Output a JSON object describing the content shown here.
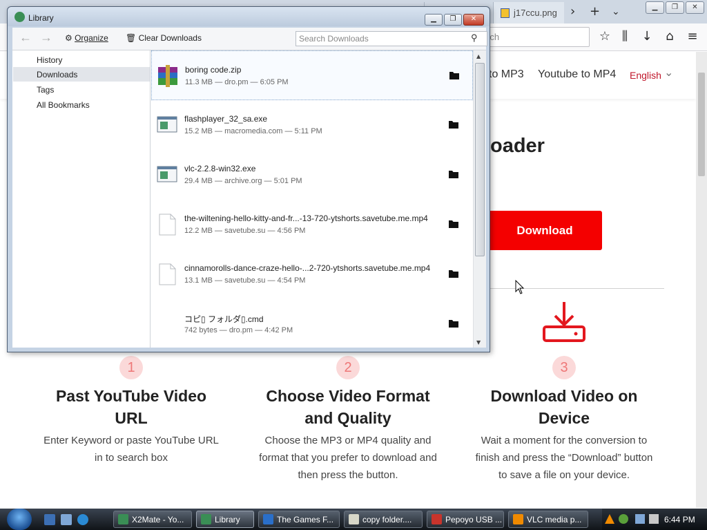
{
  "browser": {
    "tabs": {
      "image_tab_label": "j17ccu.png"
    },
    "urlbar": {
      "placeholder": "rch"
    }
  },
  "website": {
    "nav": {
      "links": [
        "to MP3",
        "Youtube to MP4"
      ],
      "language": "English"
    },
    "hero_title": "oader",
    "download_button": "Download",
    "steps": [
      {
        "num": "1",
        "title": "Past YouTube Video URL",
        "desc": "Enter Keyword or paste YouTube URL in to search box"
      },
      {
        "num": "2",
        "title": "Choose Video Format and Quality",
        "desc": "Choose the MP3 or MP4 quality and format that you prefer to download and then press the button."
      },
      {
        "num": "3",
        "title": "Download Video on Device",
        "desc": "Wait a moment for the conversion to finish and press the “Download” button to save a file on your device."
      }
    ],
    "accent_color": "#f40000"
  },
  "library": {
    "title": "Library",
    "toolbar": {
      "organize": "Organize",
      "clear_downloads": "Clear Downloads",
      "search_placeholder": "Search Downloads"
    },
    "sidebar": [
      "History",
      "Downloads",
      "Tags",
      "All Bookmarks"
    ],
    "downloads": [
      {
        "name": "boring code.zip",
        "meta": "11.3 MB — dro.pm — 6:05 PM",
        "icon": "archive-icon"
      },
      {
        "name": "flashplayer_32_sa.exe",
        "meta": "15.2 MB — macromedia.com — 5:11 PM",
        "icon": "exe-icon"
      },
      {
        "name": "vlc-2.2.8-win32.exe",
        "meta": "29.4 MB — archive.org — 5:01 PM",
        "icon": "exe-icon"
      },
      {
        "name": "the-wiltening-hello-kitty-and-fr...-13-720-ytshorts.savetube.me.mp4",
        "meta": "12.2 MB — savetube.su — 4:56 PM",
        "icon": "document-icon"
      },
      {
        "name": "cinnamorolls-dance-craze-hello-...2-720-ytshorts.savetube.me.mp4",
        "meta": "13.1 MB — savetube.su — 4:54 PM",
        "icon": "document-icon"
      },
      {
        "name": "コピ▯ フォルダ▯.cmd",
        "meta": "742 bytes — dro.pm — 4:42 PM",
        "icon": "none"
      }
    ]
  },
  "taskbar": {
    "tasks": [
      {
        "label": "X2Mate - Yo...",
        "color": "#3a8e55"
      },
      {
        "label": "Library",
        "color": "#3a8e55"
      },
      {
        "label": "The Games F...",
        "color": "#2a6fc9"
      },
      {
        "label": "copy folder....",
        "color": "#d7d7c8"
      },
      {
        "label": "Pepoyo USB ...",
        "color": "#c8342c"
      },
      {
        "label": "VLC media p...",
        "color": "#f08a00"
      }
    ],
    "clock": "6:44 PM"
  }
}
